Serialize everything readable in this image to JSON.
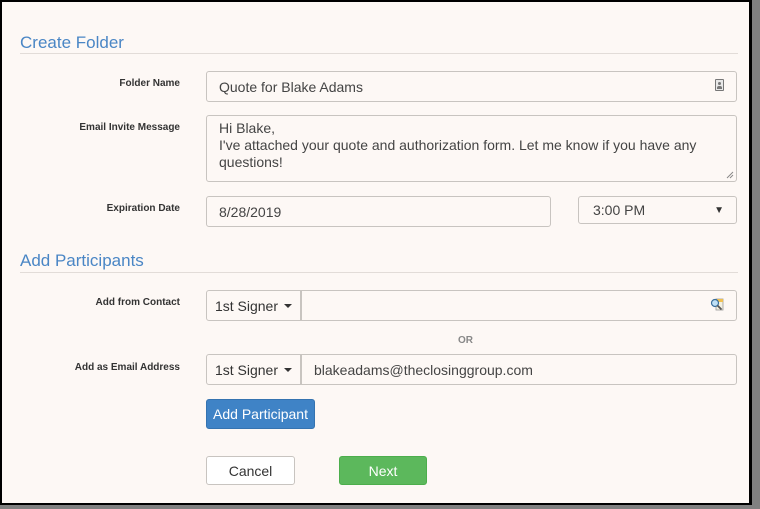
{
  "create_folder": {
    "title": "Create Folder",
    "folder_name_label": "Folder Name",
    "folder_name_value": "Quote for Blake Adams",
    "email_message_label": "Email Invite Message",
    "email_message_line1": "Hi Blake,",
    "email_message_line2": "I've attached your quote and authorization form. Let me know if you have any questions!",
    "expiration_label": "Expiration Date",
    "expiration_date": "8/28/2019",
    "expiration_time": "3:00 PM"
  },
  "add_participants": {
    "title": "Add Participants",
    "from_contact_label": "Add from Contact",
    "from_contact_role": "1st Signer",
    "from_contact_value": "",
    "or_text": "OR",
    "email_label": "Add as Email Address",
    "email_role": "1st Signer",
    "email_value": "blakeadams@theclosinggroup.com",
    "add_button": "Add Participant"
  },
  "footer": {
    "cancel": "Cancel",
    "next": "Next"
  },
  "colors": {
    "accent_blue": "#4a86c5",
    "primary_button": "#3f83c6",
    "success_button": "#5cb85c"
  }
}
